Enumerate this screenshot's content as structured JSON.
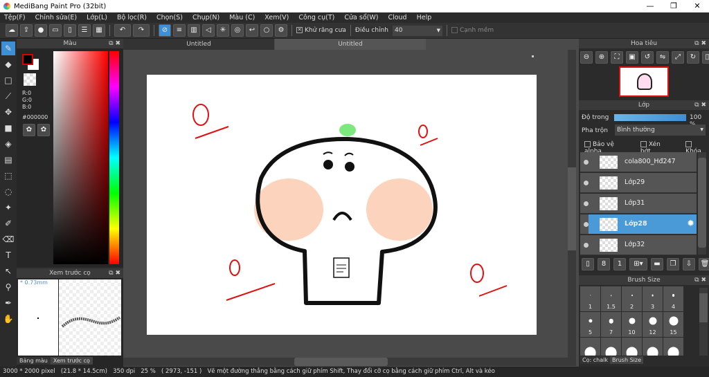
{
  "window": {
    "title": "MediBang Paint Pro (32bit)",
    "min": "—",
    "max": "❐",
    "close": "✕"
  },
  "menu": [
    "Tệp(F)",
    "Chỉnh sửa(E)",
    "Lớp(L)",
    "Bộ lọc(R)",
    "Chọn(S)",
    "Chụp(N)",
    "Màu (C)",
    "Xem(V)",
    "Công cụ(T)",
    "Cửa sổ(W)",
    "Cloud",
    "Help"
  ],
  "toolbar": {
    "antialias_label": "Khử răng cưa",
    "antialias_checked": true,
    "adjust_label": "Điều chỉnh",
    "adjust_value": "40",
    "soft_edge_label": "Cạnh mềm",
    "soft_edge_checked": false
  },
  "color_panel": {
    "title": "Màu",
    "r": "R:0",
    "g": "G:0",
    "b": "B:0",
    "hex": "#000000",
    "foreground": "#000000",
    "background": "#ffffff"
  },
  "brush_preview": {
    "title": "Xem trước cọ",
    "size": "* 0.73mm",
    "tabs": [
      "Bảng màu",
      "Xem trước cọ"
    ]
  },
  "canvas": {
    "tabs": [
      "Untitled",
      "Untitled"
    ],
    "active_tab": 1
  },
  "navigator": {
    "title": "Hoa tiêu"
  },
  "layers": {
    "title": "Lớp",
    "opacity_label": "Độ trong",
    "opacity_value": "100 %",
    "opacity": 100,
    "blend_label": "Pha trộn",
    "blend_value": "Bình thường",
    "protect_alpha": "Bảo vệ alpha",
    "clipping": "Xén bớt",
    "lock": "Khóa",
    "items": [
      {
        "name": "cola800_Hđ247",
        "selected": false
      },
      {
        "name": "Lớp29",
        "selected": false
      },
      {
        "name": "Lớp31",
        "selected": false
      },
      {
        "name": "Lớp28",
        "selected": true
      },
      {
        "name": "Lớp32",
        "selected": false
      }
    ]
  },
  "brush_size": {
    "title": "Brush Size",
    "sizes": [
      "1",
      "1.5",
      "2",
      "3",
      "4",
      "5",
      "7",
      "10",
      "12",
      "15"
    ],
    "tabs": [
      "Cọ: chalk",
      "Brush Size"
    ]
  },
  "status": {
    "dimensions": "3000 * 2000 pixel",
    "physical": "(21.8 * 14.5cm)",
    "dpi": "350 dpi",
    "zoom": "25 %",
    "coords": "( 2973, -151 )",
    "hint": "Vẽ một đường thẳng bằng cách giữ phím Shift, Thay đổi cỡ cọ bằng cách giữ phím Ctrl, Alt và kéo"
  },
  "colors": {
    "accent": "#3d8fd6",
    "sketch": "#e01010",
    "blush": "#fbcbb0",
    "sprout": "#7de87d"
  }
}
